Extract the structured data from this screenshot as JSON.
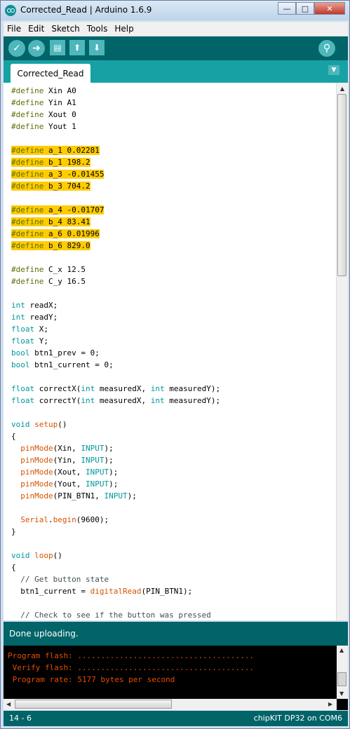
{
  "window": {
    "title": "Corrected_Read | Arduino 1.6.9",
    "buttons": {
      "minimize": "—",
      "maximize": "□",
      "close": "✕"
    }
  },
  "menu": [
    "File",
    "Edit",
    "Sketch",
    "Tools",
    "Help"
  ],
  "toolbar": {
    "verify_icon": "check-icon",
    "upload_icon": "arrow-right-icon",
    "new_icon": "new-file-icon",
    "open_icon": "open-up-icon",
    "save_icon": "save-down-icon",
    "serial_icon": "magnifier-icon"
  },
  "tab": {
    "label": "Corrected_Read",
    "menu_glyph": "▼"
  },
  "code_lines": [
    "#define Xin A0",
    "#define Yin A1",
    "#define Xout 0",
    "#define Yout 1",
    "",
    "#define a_1 0.02281",
    "#define b_1 198.2",
    "#define a_3 -0.01455",
    "#define b_3 704.2",
    "",
    "#define a_4 -0.01707",
    "#define b_4 83.41",
    "#define a_6 0.01996",
    "#define b_6 829.0",
    "",
    "#define C_x 12.5",
    "#define C_y 16.5",
    "",
    "int readX;",
    "int readY;",
    "float X;",
    "float Y;",
    "bool btn1_prev = 0;",
    "bool btn1_current = 0;",
    "",
    "float correctX(int measuredX, int measuredY);",
    "float correctY(int measuredX, int measuredY);",
    "",
    "void setup()",
    "{",
    "  pinMode(Xin, INPUT);",
    "  pinMode(Yin, INPUT);",
    "  pinMode(Xout, INPUT);",
    "  pinMode(Yout, INPUT);",
    "  pinMode(PIN_BTN1, INPUT);",
    "",
    "  Serial.begin(9600);",
    "}",
    "",
    "void loop()",
    "{",
    "  // Get button state",
    "  btn1_current = digitalRead(PIN_BTN1);",
    "",
    "  // Check to see if the button was pressed"
  ],
  "highlighted_lines": [
    5,
    6,
    7,
    8,
    10,
    11,
    12,
    13
  ],
  "status": {
    "message": "Done uploading."
  },
  "console_lines": [
    "Program flash: ......................................",
    " Verify flash: ......................................",
    " Program rate: 5177 bytes per second"
  ],
  "footer": {
    "line_col": "14 - 6",
    "board": "chipKIT DP32 on COM6"
  },
  "colors": {
    "toolbar": "#006468",
    "tabbar": "#17a1a5",
    "highlight": "#ffcc00",
    "console_text": "#e34c00"
  }
}
